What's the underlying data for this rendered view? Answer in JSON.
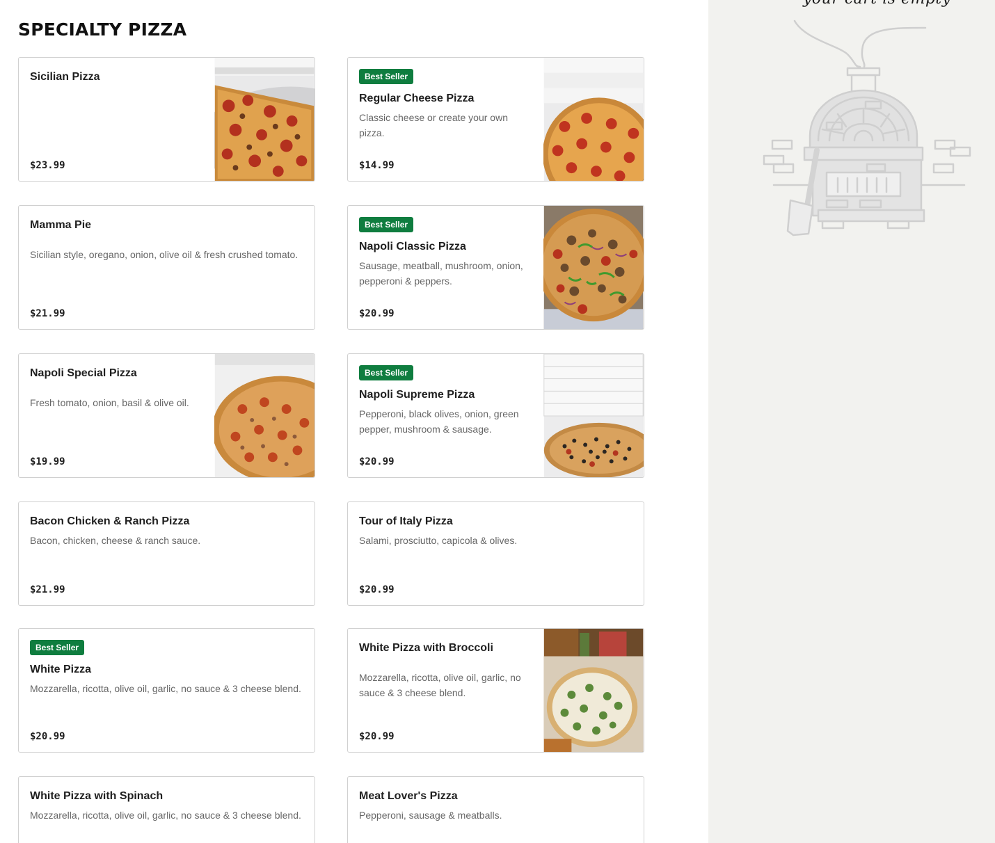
{
  "section": {
    "title": "SPECIALTY PIZZA"
  },
  "badge_label": "Best Seller",
  "items": [
    {
      "name": "Sicilian Pizza",
      "description": "",
      "price": "$23.99",
      "best_seller": false,
      "has_image": true
    },
    {
      "name": "Regular Cheese Pizza",
      "description": "Classic cheese or create your own pizza.",
      "price": "$14.99",
      "best_seller": true,
      "has_image": true
    },
    {
      "name": "Mamma Pie",
      "description": "Sicilian style, oregano, onion, olive oil & fresh crushed tomato.",
      "price": "$21.99",
      "best_seller": false,
      "has_image": false
    },
    {
      "name": "Napoli Classic Pizza",
      "description": "Sausage, meatball, mushroom, onion, pepperoni & peppers.",
      "price": "$20.99",
      "best_seller": true,
      "has_image": true
    },
    {
      "name": "Napoli Special Pizza",
      "description": "Fresh tomato, onion, basil & olive oil.",
      "price": "$19.99",
      "best_seller": false,
      "has_image": true
    },
    {
      "name": "Napoli Supreme Pizza",
      "description": "Pepperoni, black olives, onion, green pepper, mushroom & sausage.",
      "price": "$20.99",
      "best_seller": true,
      "has_image": true
    },
    {
      "name": "Bacon Chicken & Ranch Pizza",
      "description": "Bacon, chicken, cheese & ranch sauce.",
      "price": "$21.99",
      "best_seller": false,
      "has_image": false
    },
    {
      "name": "Tour of Italy Pizza",
      "description": "Salami, prosciutto, capicola & olives.",
      "price": "$20.99",
      "best_seller": false,
      "has_image": false
    },
    {
      "name": "White Pizza",
      "description": "Mozzarella, ricotta, olive oil, garlic, no sauce & 3 cheese blend.",
      "price": "$20.99",
      "best_seller": true,
      "has_image": false
    },
    {
      "name": "White Pizza with Broccoli",
      "description": "Mozzarella, ricotta, olive oil, garlic, no sauce & 3 cheese blend.",
      "price": "$20.99",
      "best_seller": false,
      "has_image": true
    },
    {
      "name": "White Pizza with Spinach",
      "description": "Mozzarella, ricotta, olive oil, garlic, no sauce & 3 cheese blend.",
      "price": "",
      "best_seller": false,
      "has_image": false
    },
    {
      "name": "Meat Lover's Pizza",
      "description": "Pepperoni, sausage & meatballs.",
      "price": "",
      "best_seller": false,
      "has_image": false
    }
  ],
  "cart": {
    "empty_text": "your cart is empty",
    "illustration": "pizza-oven-icon"
  },
  "colors": {
    "badge": "#0f7d3f",
    "cart_bg": "#f2f2ef",
    "border": "#d0d0d0"
  }
}
